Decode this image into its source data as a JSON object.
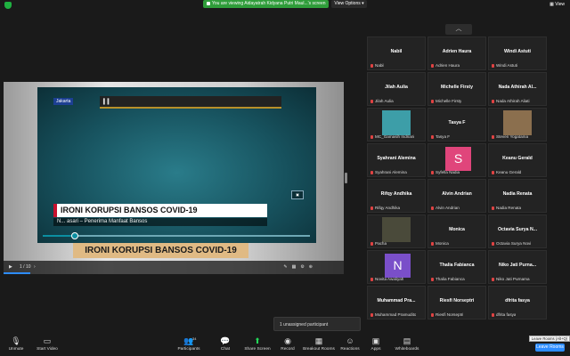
{
  "top_bar": {
    "viewing_text": "You are viewing Aidayatrah Kidyana Putri Maul...'s screen",
    "view_options": "View Options",
    "view": "View"
  },
  "share": {
    "location_tag": "Jakarta",
    "headline": "IRONI KORUPSI BANSOS COVID-19",
    "subtitle": "N... asari – Penerima Manfaat Bansos",
    "caption": "IRONI KORUPSI BANSOS COVID-19",
    "page_indicator": "1 / 10",
    "progress_percent": 12
  },
  "gallery": {
    "tiles": [
      {
        "name": "Nabil",
        "label": "Nabil"
      },
      {
        "name": "Adrien Haura",
        "label": "Adrien Haura"
      },
      {
        "name": "Windi Astuti",
        "label": "Windi Astuti"
      },
      {
        "name": "Jilah Aulia",
        "label": "Jilah Aulia"
      },
      {
        "name": "Michelle Firsty",
        "label": "Michelle Firsty"
      },
      {
        "name": "Nada Athirah Al...",
        "label": "Nada Athirah Aliati"
      },
      {
        "name": "",
        "label": "MC_Gamasih Indriani",
        "photo": "#3d9ea8"
      },
      {
        "name": "Tasya F",
        "label": "Tasya F"
      },
      {
        "name": "",
        "label": "Steven Yogatama",
        "photo": "#8b6f4e"
      },
      {
        "name": "Syahrani Alemina",
        "label": "Syahrani Alemina"
      },
      {
        "name": "",
        "label": "Syfella Nadia",
        "avatar": "S",
        "avatar_color": "#e0457b"
      },
      {
        "name": "Keanu Gerald",
        "label": "Keanu Gerald"
      },
      {
        "name": "Rifqy Andhika",
        "label": "Rifqy Andhika"
      },
      {
        "name": "Alvin Andrian",
        "label": "Alvin Andrian"
      },
      {
        "name": "Nadia Renata",
        "label": "Nadia Renata"
      },
      {
        "name": "",
        "label": "Pacha",
        "photo": "#4a4a3a"
      },
      {
        "name": "Monica",
        "label": "Monica"
      },
      {
        "name": "Octavia Surya N...",
        "label": "Octavia Surya Novi"
      },
      {
        "name": "",
        "label": "Novita Awaliyah",
        "avatar": "N",
        "avatar_color": "#7a4fc9"
      },
      {
        "name": "Thalia Fabianca",
        "label": "Thalia Fabianca"
      },
      {
        "name": "Niko Jati Purna...",
        "label": "Niko Jati Purnama"
      },
      {
        "name": "Muhammad Pra...",
        "label": "Muhammad Pramudito"
      },
      {
        "name": "Riesfi Norseptri",
        "label": "Riesfi Norseptri"
      },
      {
        "name": "dfrita fasya",
        "label": "dfrita fasya"
      }
    ]
  },
  "unassigned": "1 unassigned participant",
  "toolbar": {
    "unmute": "Unmute",
    "start_video": "Start Video",
    "participants": "Participants",
    "participants_count": "34",
    "chat": "Chat",
    "share_screen": "Share Screen",
    "record": "Record",
    "breakout_rooms": "Breakout Rooms",
    "reactions": "Reactions",
    "apps": "Apps",
    "whiteboards": "Whiteboards",
    "leave_rooms": "Leave Rooms",
    "leave_tooltip": "Leave Rooms (Alt+Q)"
  }
}
